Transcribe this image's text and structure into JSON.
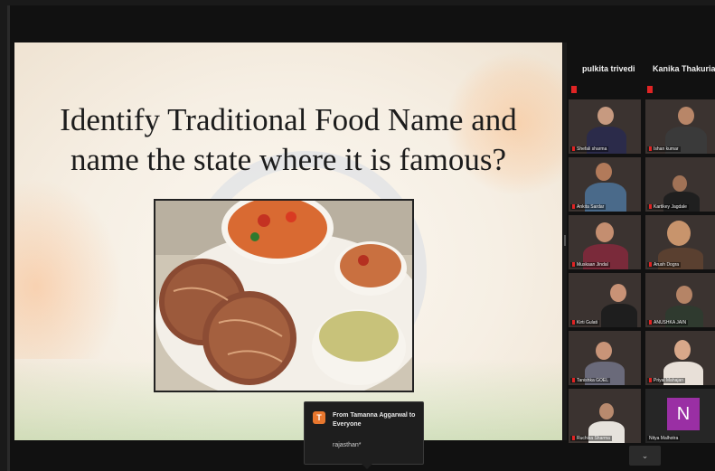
{
  "slide": {
    "title_line1": "Identify Traditional Food Name and",
    "title_line2": "name the state where it is famous?"
  },
  "chat_popup": {
    "avatar_letter": "T",
    "sender": "From Tamanna Aggarwal to Everyone",
    "message": "rajasthan*"
  },
  "gallery": {
    "top_row": [
      {
        "name": "pulkita trivedi"
      },
      {
        "name": "Kanika Thakuria"
      }
    ],
    "tiles": [
      {
        "name": "Shefali sharma",
        "bg": "#4a3b35"
      },
      {
        "name": "Ishan kumar",
        "bg": "#5a4a40"
      },
      {
        "name": "Ankita Sardar",
        "bg": "#6b5a4a"
      },
      {
        "name": "Kartikey Jagdale",
        "bg": "#2e2a28"
      },
      {
        "name": "Muskaan Jindal",
        "bg": "#7a5a4a"
      },
      {
        "name": "Arush Dogra",
        "bg": "#a07a4a"
      },
      {
        "name": "Kirti Gulati",
        "bg": "#5c3e3a"
      },
      {
        "name": "ANUSHKA JAIN",
        "bg": "#4b4f3e"
      },
      {
        "name": "Tanishka GOEL",
        "bg": "#8a6a5a"
      },
      {
        "name": "Priyal Mahajan",
        "bg": "#c6a38a"
      },
      {
        "name": "Ruchika Sharma",
        "bg": "#6a5548"
      },
      {
        "name": "Nitya Malhotra",
        "bg": "#262626",
        "avatar_letter": "N"
      }
    ]
  },
  "colors": {
    "accent_orange": "#e8772e",
    "mic_muted": "#e02424",
    "avatar_purple": "#9a2fa4"
  },
  "icons": {
    "scroll_down": "chevron-down-icon",
    "scroll_down_glyph": "⌄"
  }
}
